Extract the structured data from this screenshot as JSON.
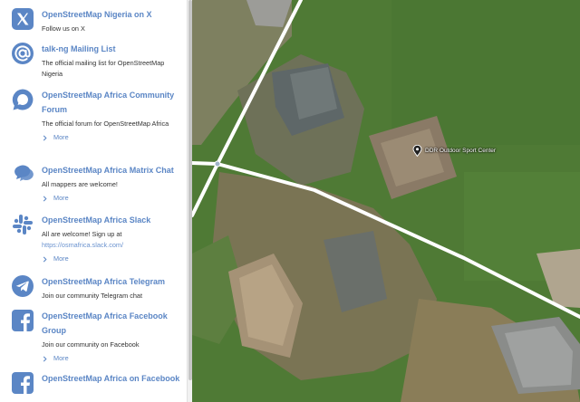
{
  "colors": {
    "accent": "#5b86c5",
    "icon_blue": "#5b86c5",
    "road": "#ffffff",
    "vegetation": "#4f7a35"
  },
  "sidebar": {
    "items": [
      {
        "icon": "x-logo-icon",
        "title": "OpenStreetMap Nigeria on X",
        "desc": "Follow us on X",
        "more": ""
      },
      {
        "icon": "at-sign-icon",
        "title": "talk-ng Mailing List",
        "desc": "The official mailing list for OpenStreetMap Nigeria",
        "more": ""
      },
      {
        "icon": "forum-chat-icon",
        "title": "OpenStreetMap Africa Community Forum",
        "desc": "The official forum for OpenStreetMap Africa",
        "more": "More"
      },
      {
        "icon": "matrix-chat-icon",
        "title": "OpenStreetMap Africa Matrix Chat",
        "desc": "All mappers are welcome!",
        "more": "More"
      },
      {
        "icon": "slack-icon",
        "title": "OpenStreetMap Africa Slack",
        "desc": "All are welcome! Sign up at",
        "link": "https://osmafrica.slack.com/",
        "more": "More"
      },
      {
        "icon": "telegram-icon",
        "title": "OpenStreetMap Africa Telegram",
        "desc": "Join our community Telegram chat",
        "more": ""
      },
      {
        "icon": "facebook-icon",
        "title": "OpenStreetMap Africa Facebook Group",
        "desc": "Join our community on Facebook",
        "more": "More"
      },
      {
        "icon": "facebook-icon",
        "title": "OpenStreetMap Africa on Facebook",
        "desc": "",
        "more": ""
      }
    ]
  },
  "map": {
    "poi_label": "DDR Outdoor Sport Center",
    "poi_icon": "sport-center-pin-icon"
  }
}
